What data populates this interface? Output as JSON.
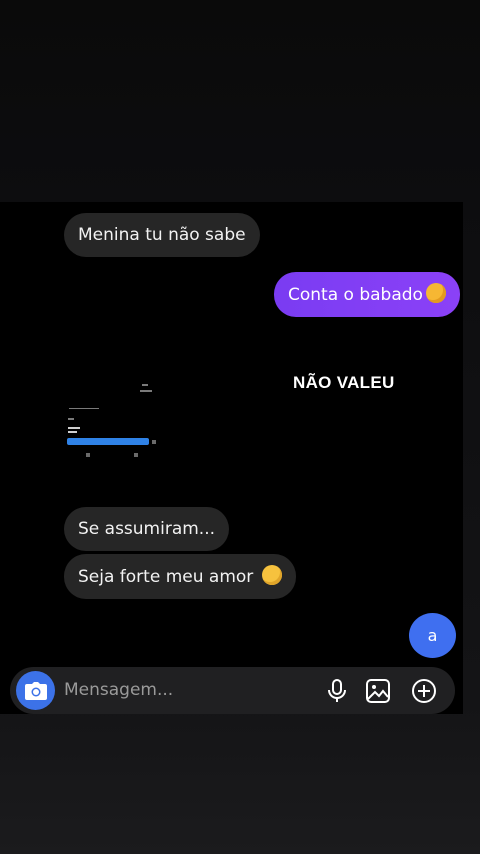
{
  "messages": [
    {
      "text": "Menina tu não sabe",
      "direction": "incoming"
    },
    {
      "text": "Conta o babado",
      "direction": "outgoing",
      "emoji": "smiling-face-with-hearts"
    },
    {
      "text": "Se assumiram...",
      "direction": "incoming"
    },
    {
      "text": "Seja forte meu amor",
      "direction": "incoming",
      "emoji": "pleading-face"
    },
    {
      "text": "a",
      "direction": "outgoing"
    }
  ],
  "caption": "NÃO VALEU",
  "composer": {
    "placeholder": "Mensagem...",
    "icons": [
      "camera-icon",
      "microphone-icon",
      "gallery-icon",
      "plus-icon"
    ]
  },
  "colors": {
    "incoming_bubble": "#262626",
    "outgoing_bubble": "#8b41f7",
    "accent_blue": "#3f6ff0"
  }
}
